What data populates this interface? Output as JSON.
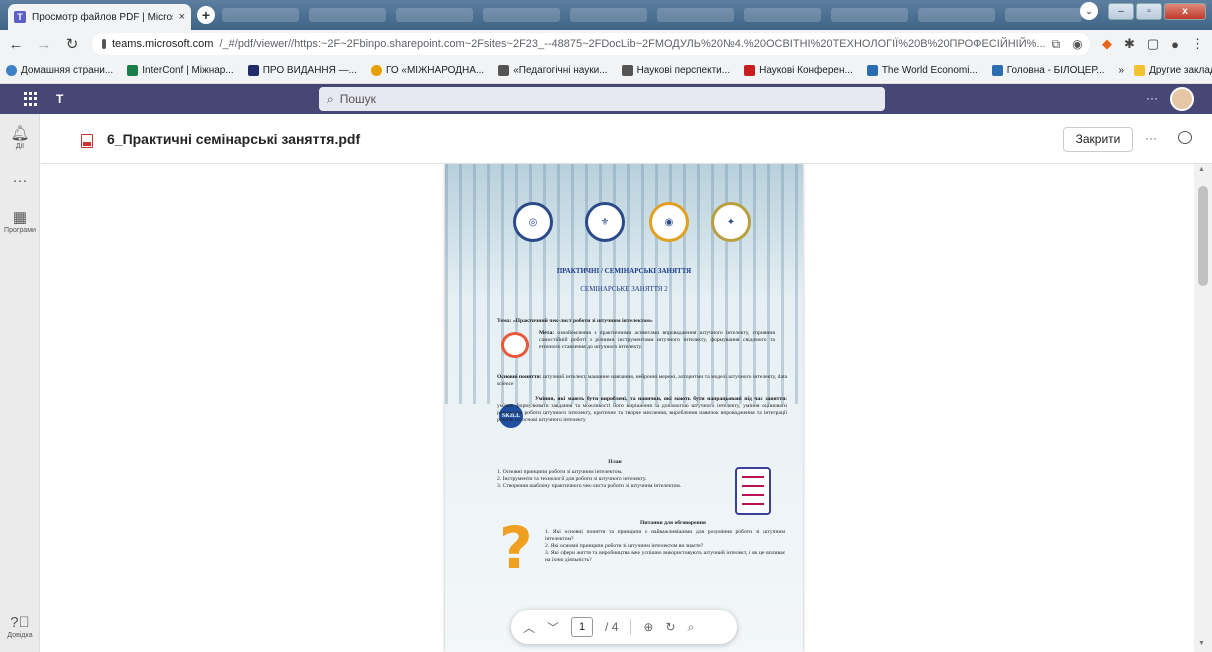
{
  "browser": {
    "tab_title": "Просмотр файлов PDF | Microsoft Teams",
    "tab_close": "×",
    "new_tab": "+",
    "url_domain": "teams.microsoft.com",
    "url_path": "/_#/pdf/viewer//https:~2F~2Fbinpo.sharepoint.com~2Fsites~2F23_--48875~2FDocLib~2FМОДУЛЬ%20№4.%20ОСВІТНІ%20ТЕХНОЛОГІЇ%20В%20ПРОФЕСІЙНІЙ%...",
    "bookmarks": [
      {
        "label": "Домашняя страни...",
        "color": "#3b82c4"
      },
      {
        "label": "InterConf | Міжнар...",
        "color": "#1a7f4b"
      },
      {
        "label": "ПРО ВИДАННЯ —...",
        "color": "#1f2d6b"
      },
      {
        "label": "ГО «МІЖНАРОДНА...",
        "color": "#e8a000"
      },
      {
        "label": "«Педагогічні науки...",
        "color": "#555555"
      },
      {
        "label": "Наукові перспекти...",
        "color": "#555555"
      },
      {
        "label": "Наукові Конферен...",
        "color": "#c81e1e"
      },
      {
        "label": "The World Economi...",
        "color": "#2a6db0"
      },
      {
        "label": "Головна - БІЛОЦЕР...",
        "color": "#2a6db0"
      }
    ],
    "bookmarks_more": "»",
    "other_bookmarks": "Другие закладки"
  },
  "teams": {
    "search_placeholder": "Пошук",
    "more": "···",
    "rail": [
      {
        "label": "Дії",
        "icon": "bell-icon"
      },
      {
        "label": "",
        "icon": "more-icon"
      },
      {
        "label": "Програми",
        "icon": "apps-icon"
      },
      {
        "label": "Довідка",
        "icon": "help-icon"
      }
    ]
  },
  "viewer": {
    "file_name": "6_Практичні семінарські заняття.pdf",
    "close_label": "Закрити",
    "more": "···",
    "current_page": "1",
    "total_pages": "/ 4"
  },
  "pdf_page": {
    "heading1": "ПРАКТИЧНІ / СЕМІНАРСЬКІ ЗАНЯТТЯ",
    "heading2": "СЕМІНАРСЬКЕ ЗАНЯТТЯ 2",
    "topic": "Тема: «Практичний чек-лист роботи зі штучним інтелектом»",
    "goal_label": "Мета:",
    "goal_text": "ознайомлення з практичними аспектами впровадження штучного інтелекту, сприяння самостійній роботі з різними інструментами штучного інтелекту, формування свідомого та етичного ставлення до штучного інтелекту.",
    "concepts_label": "Основні поняття:",
    "concepts_text": "штучний інтелект, машинне навчання, нейронні мережі, алгоритми та моделі штучного інтелекту, data science",
    "skills_label": "Уміння, які мають бути вироблені, та навички, які мають бути напрацьовані під час заняття:",
    "skills_text": "уміння формулювати завдання та можливості його вирішення за допомогою штучного інтелекту, уміння оцінювати результати роботи штучного інтелекту, критичне та творче мислення, вироблення навичок впровадження та інтеграції рішень на основі штучного інтелекту",
    "skill_badge": "SKILL",
    "plan_title": "План",
    "plan_items": [
      "1. Основні принципи роботи зі штучним інтелектом.",
      "2. Інструменти та технології для роботи зі штучного інтелекту.",
      "3. Створення шаблону практичного чек-листа роботи зі штучним інтелектом."
    ],
    "questions_title": "Питання для обговорення",
    "questions": [
      "1. Які основні поняття та принципи є найважливішими для розуміння роботи зі штучним інтелектом?",
      "2. Які основні принципи роботи зі штучним інтелектом ви знаєте?",
      "3. Які сфери життя та виробництва вже успішно використовують штучний інтелект, і як це впливає на їхню діяльність?"
    ]
  },
  "colors": {
    "teams_bar": "#464775",
    "accent": "#5b5fc7"
  }
}
